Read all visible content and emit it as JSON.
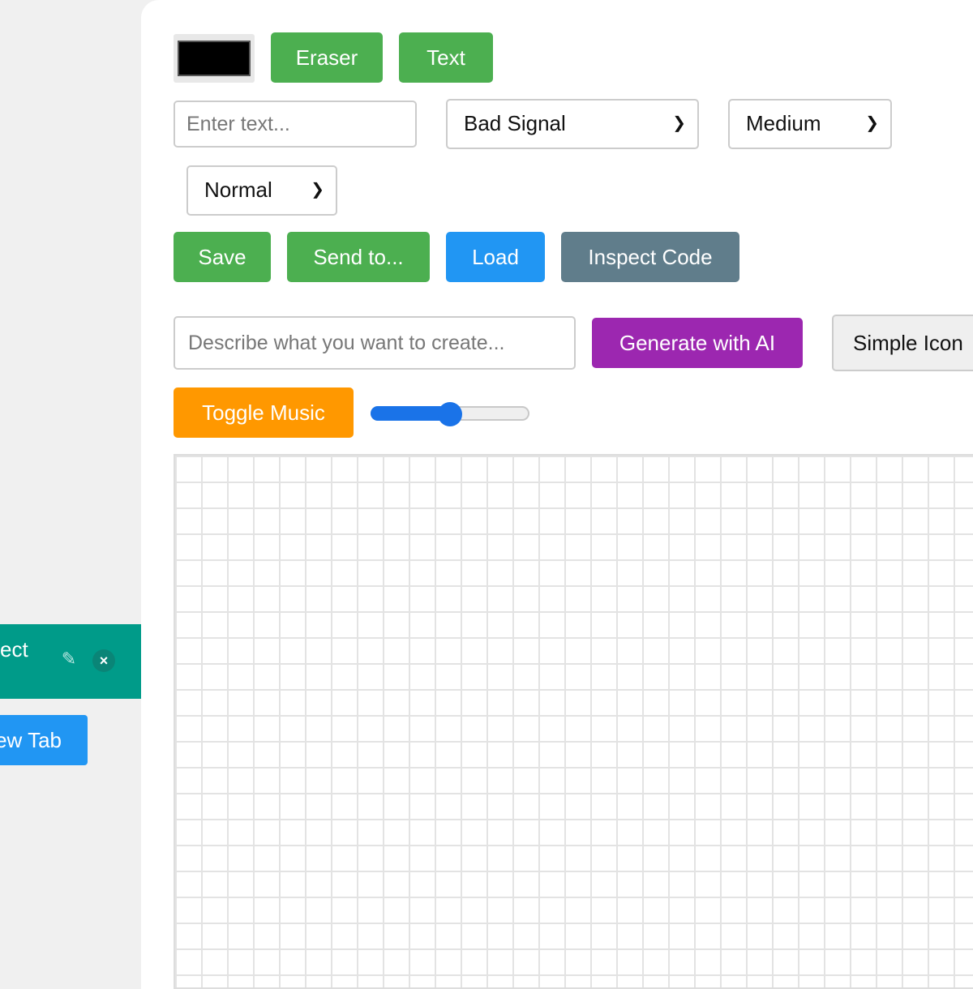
{
  "sidebar": {
    "active_tab": {
      "label": "ect",
      "edit_icon": "pencil-icon",
      "close_icon": "close-icon",
      "close_glyph": "×"
    },
    "new_tab_label": "ew Tab"
  },
  "toolbar": {
    "color": "#000000",
    "eraser_label": "Eraser",
    "text_label": "Text",
    "text_placeholder": "Enter text...",
    "font_select": "Bad Signal",
    "size_select": "Medium",
    "style_select": "Normal",
    "save_label": "Save",
    "send_label": "Send to...",
    "load_label": "Load",
    "inspect_label": "Inspect Code"
  },
  "ai": {
    "prompt_placeholder": "Describe what you want to create...",
    "generate_label": "Generate with AI",
    "simple_icon_label": "Simple Icon"
  },
  "music": {
    "toggle_label": "Toggle Music",
    "volume": 0.5
  },
  "colors": {
    "green": "#4caf50",
    "blue": "#2196f3",
    "gray": "#607d8b",
    "purple": "#9c27b0",
    "orange": "#ff9800",
    "teal": "#009b89"
  }
}
